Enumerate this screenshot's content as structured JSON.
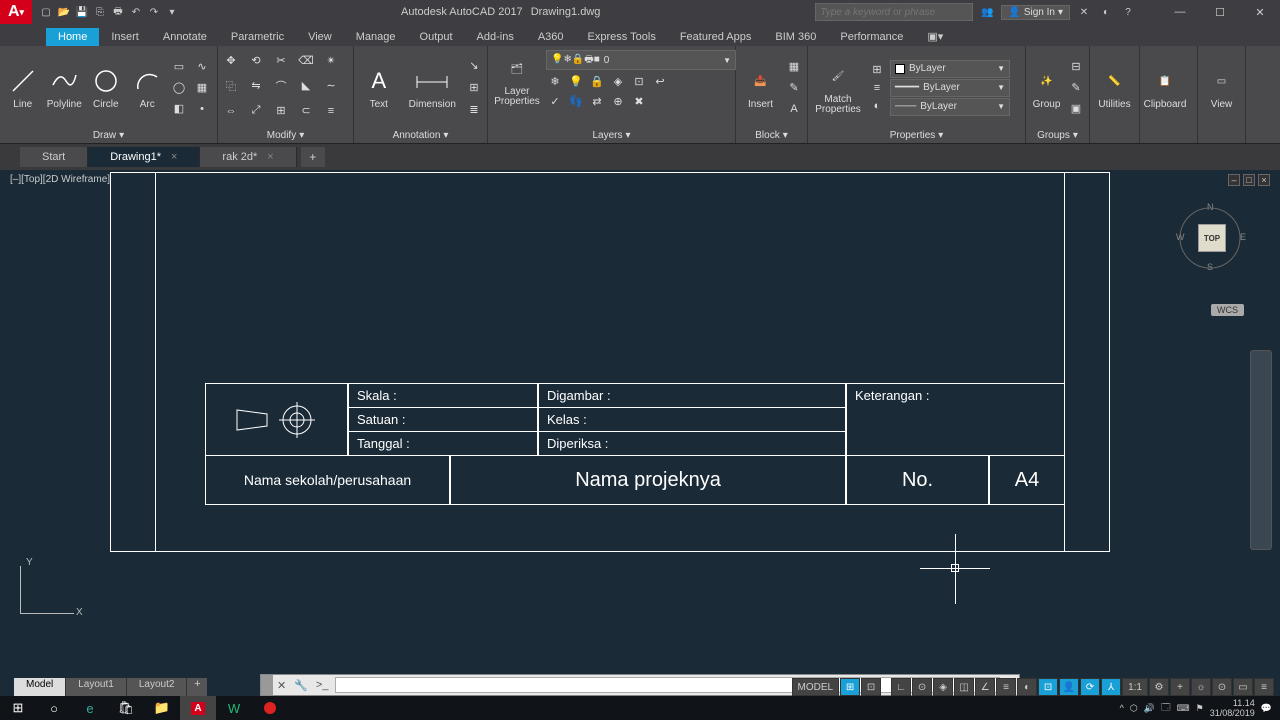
{
  "title": {
    "app": "Autodesk AutoCAD 2017",
    "doc": "Drawing1.dwg"
  },
  "search": {
    "placeholder": "Type a keyword or phrase"
  },
  "signin": "Sign In",
  "ribbonTabs": [
    "Home",
    "Insert",
    "Annotate",
    "Parametric",
    "View",
    "Manage",
    "Output",
    "Add-ins",
    "A360",
    "Express Tools",
    "Featured Apps",
    "BIM 360",
    "Performance"
  ],
  "activeRibbonTab": "Home",
  "draw": {
    "line": "Line",
    "polyline": "Polyline",
    "circle": "Circle",
    "arc": "Arc",
    "panel": "Draw"
  },
  "modify": {
    "panel": "Modify"
  },
  "annotation": {
    "text": "Text",
    "dimension": "Dimension",
    "panel": "Annotation"
  },
  "layers": {
    "btn": "Layer\nProperties",
    "current": "0",
    "panel": "Layers"
  },
  "block": {
    "insert": "Insert",
    "match": "Match\nProperties",
    "panel": "Block"
  },
  "properties": {
    "bylayer": "ByLayer",
    "panel": "Properties"
  },
  "groups": {
    "group": "Group",
    "panel": "Groups"
  },
  "utilities": {
    "label": "Utilities"
  },
  "clipboard": {
    "label": "Clipboard"
  },
  "view": {
    "label": "View"
  },
  "fileTabs": [
    "Start",
    "Drawing1*",
    "rak 2d*"
  ],
  "activeFileTab": "Drawing1*",
  "viewport": {
    "label": "[–][Top][2D Wireframe]"
  },
  "viewcube": {
    "n": "N",
    "s": "S",
    "e": "E",
    "w": "W",
    "face": "TOP",
    "wcs": "WCS"
  },
  "titleBlock": {
    "skala": "Skala    :",
    "satuan": "Satuan   :",
    "tanggal": "Tanggal :",
    "digambar": "Digambar :",
    "kelas": "Kelas       :",
    "diperiksa": "Diperiksa  :",
    "keterangan": "Keterangan :",
    "sekolah": "Nama sekolah/perusahaan",
    "projek": "Nama projeknya",
    "no": "No.",
    "size": "A4"
  },
  "ucs": {
    "x": "X",
    "y": "Y"
  },
  "layoutTabs": [
    "Model",
    "Layout1",
    "Layout2"
  ],
  "status": {
    "model": "MODEL",
    "scale": "1:1"
  },
  "cmd": {
    "prompt": ">_"
  },
  "tray": {
    "time": "11.14",
    "date": "31/08/2019"
  }
}
